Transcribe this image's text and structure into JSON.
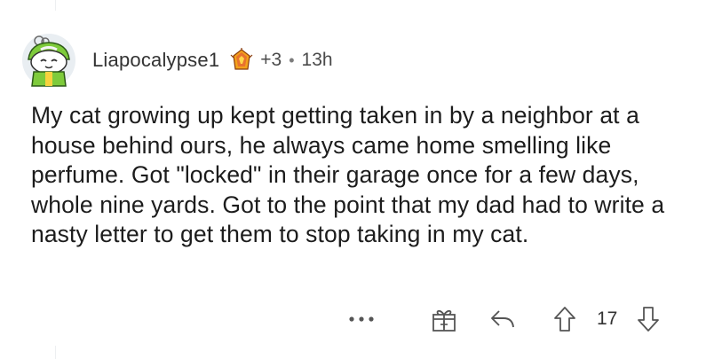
{
  "comment": {
    "username": "Liapocalypse1",
    "award_count": "+3",
    "separator": "•",
    "timestamp": "13h",
    "body": "My cat growing up kept getting taken in by a neighbor at a house behind ours, he always came home smelling like perfume. Got \"locked\" in their garage once for a few days, whole nine yards. Got to the point that my dad had to write a nasty letter to get them to stop taking in my cat."
  },
  "actions": {
    "more_label": "•••",
    "vote_count": "17",
    "icons": [
      "more-icon",
      "gift-icon",
      "reply-icon",
      "upvote-arrow-icon",
      "downvote-arrow-icon"
    ]
  },
  "colors": {
    "avatar_green": "#7ecb3b",
    "award_orange": "#e8722e",
    "text": "#1c1c1c",
    "meta": "#4a4a4a"
  }
}
